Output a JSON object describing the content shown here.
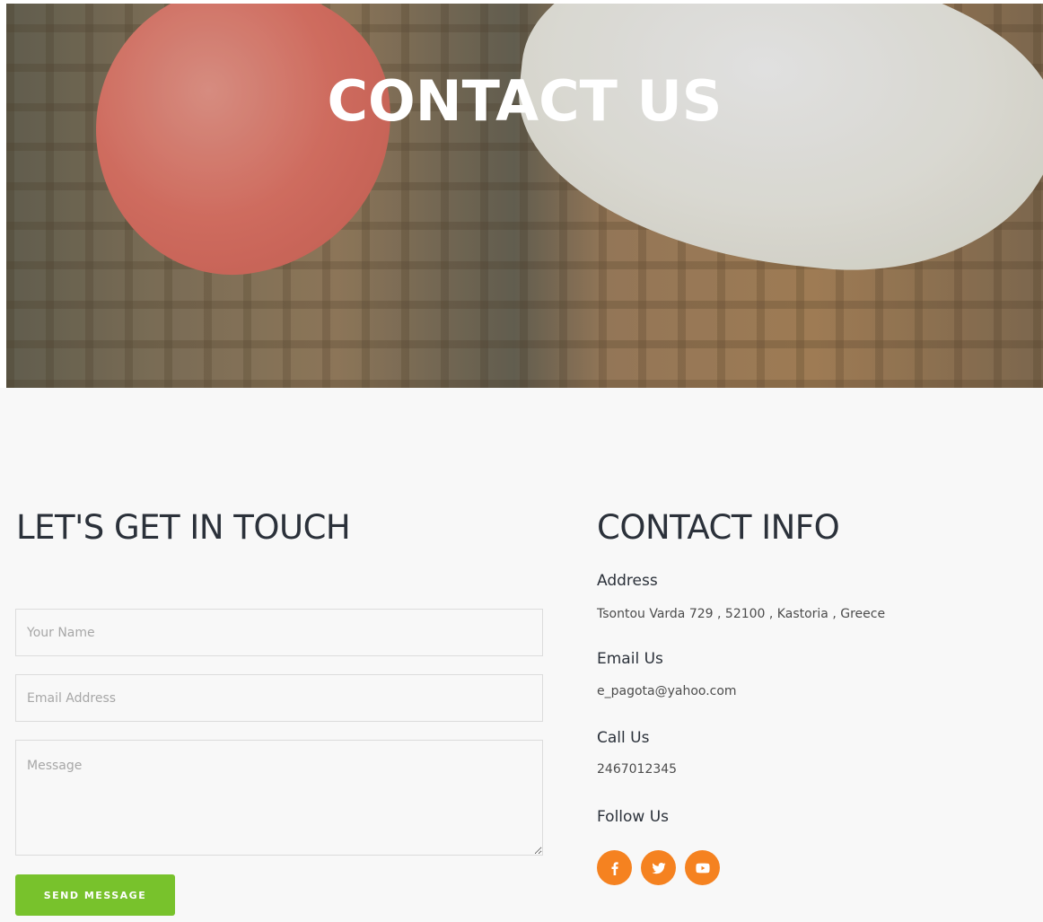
{
  "hero": {
    "title": "CONTACT US"
  },
  "form": {
    "heading": "LET'S GET IN TOUCH",
    "name_placeholder": "Your Name",
    "email_placeholder": "Email Address",
    "message_placeholder": "Message",
    "send_label": "SEND MESSAGE"
  },
  "contact": {
    "heading": "CONTACT INFO",
    "address_label": "Address",
    "address_value": "Tsontou Varda 729 , 52100 , Kastoria , Greece",
    "email_label": "Email Us",
    "email_value": "e_pagota@yahoo.com",
    "call_label": "Call Us",
    "call_value": "2467012345",
    "follow_label": "Follow Us",
    "social": [
      "facebook-icon",
      "twitter-icon",
      "youtube-icon"
    ]
  },
  "colors": {
    "accent_green": "#78c22c",
    "social_orange": "#f58220",
    "heading_text": "#2b313a",
    "page_bg": "#f8f8f8"
  }
}
